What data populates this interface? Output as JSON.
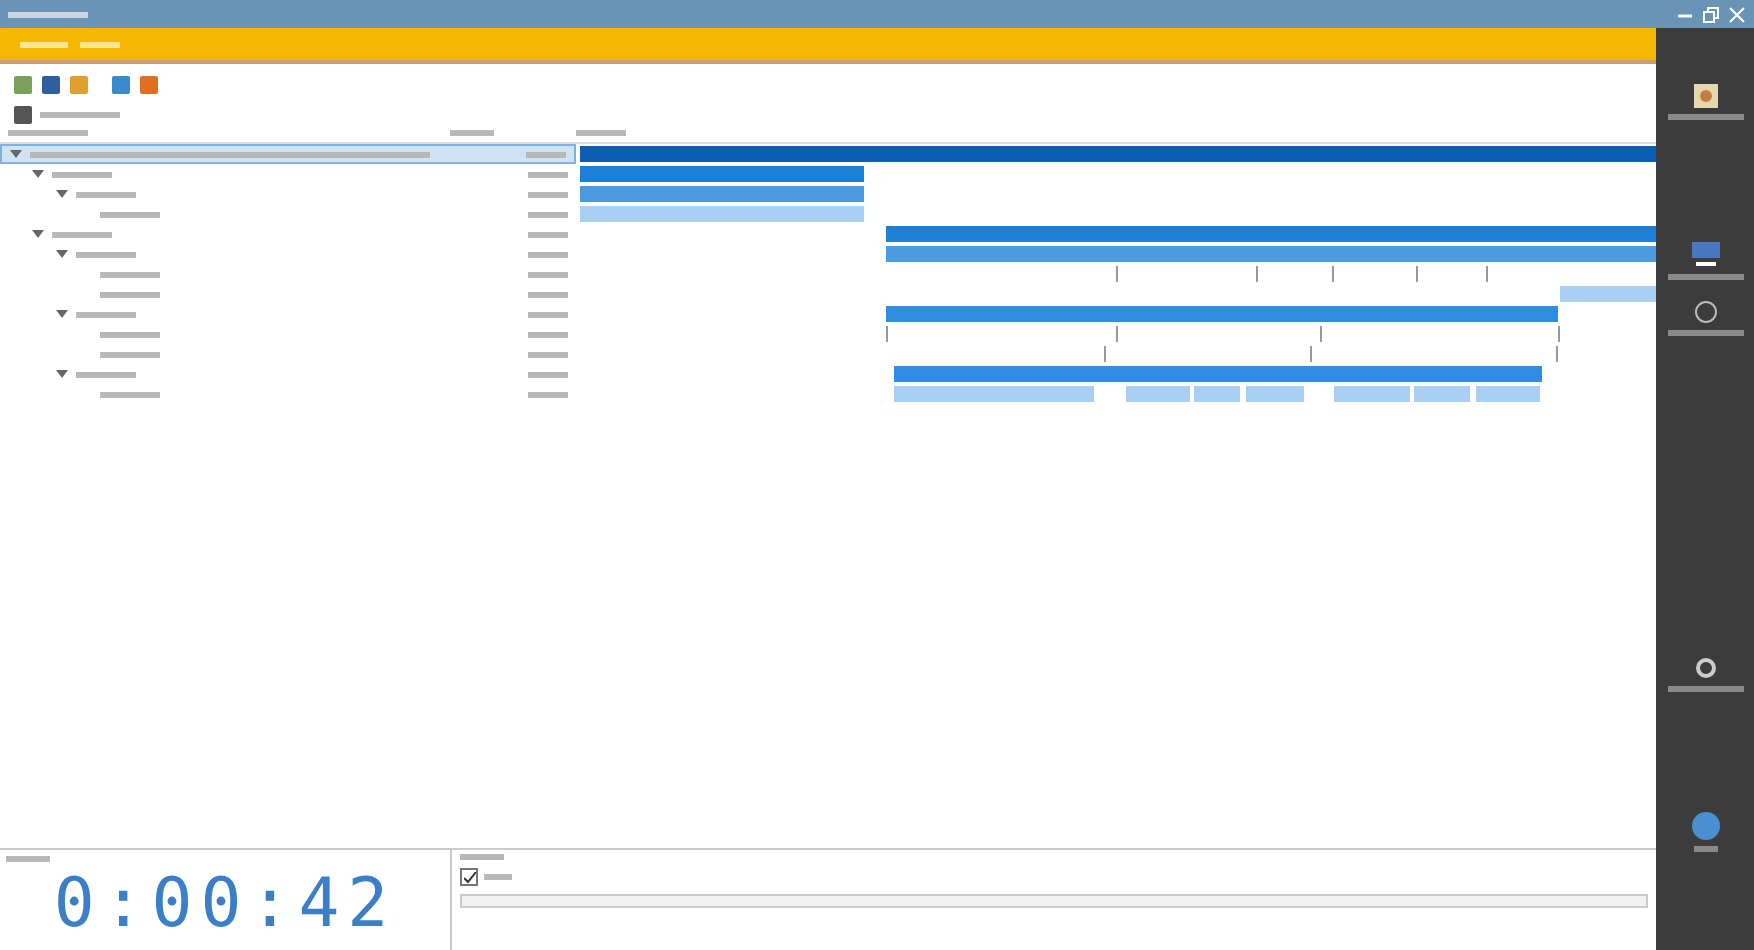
{
  "timer": {
    "value": "0:00:42"
  },
  "tree": [
    {
      "selected": true,
      "expanded": true,
      "children": [
        {
          "selected": false,
          "expanded": true,
          "children": [
            {
              "selected": false,
              "expanded": true,
              "children": [
                {
                  "selected": false
                }
              ]
            }
          ]
        },
        {
          "selected": false,
          "expanded": true,
          "children": [
            {
              "selected": false,
              "expanded": true,
              "children": [
                {
                  "selected": false
                },
                {
                  "selected": false
                }
              ]
            },
            {
              "selected": false,
              "expanded": true,
              "children": [
                {
                  "selected": false
                },
                {
                  "selected": false
                }
              ]
            },
            {
              "selected": false,
              "expanded": true,
              "children": [
                {
                  "selected": false
                }
              ]
            }
          ]
        }
      ]
    }
  ],
  "log_option": {
    "checked": true
  }
}
